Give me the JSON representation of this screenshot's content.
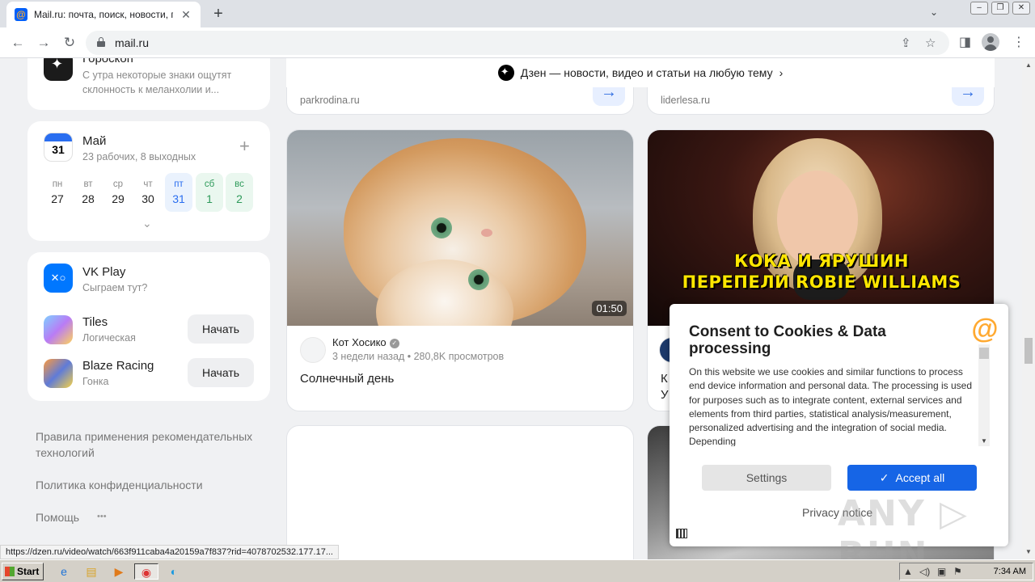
{
  "browser": {
    "tab_title": "Mail.ru: почта, поиск, новости, пр",
    "tab_close": "✕",
    "new_tab": "+",
    "url": "mail.ru",
    "status_url": "https://dzen.ru/video/watch/663f911caba4a20159a7f837?rid=4078702532.177.17..."
  },
  "sidebar": {
    "horoscope": {
      "title": "Гороскоп",
      "text": "С утра некоторые знаки ощутят склонность к меланхолии и..."
    },
    "calendar": {
      "icon_day": "31",
      "month": "Май",
      "summary": "23 рабочих, 8 выходных",
      "days": [
        {
          "name": "пн",
          "date": "27"
        },
        {
          "name": "вт",
          "date": "28"
        },
        {
          "name": "ср",
          "date": "29"
        },
        {
          "name": "чт",
          "date": "30"
        },
        {
          "name": "пт",
          "date": "31"
        },
        {
          "name": "сб",
          "date": "1"
        },
        {
          "name": "вс",
          "date": "2"
        }
      ]
    },
    "games": {
      "title": "VK Play",
      "subtitle": "Сыграем тут?",
      "icon_text": "✕○",
      "items": [
        {
          "name": "Tiles",
          "genre": "Логическая",
          "button": "Начать"
        },
        {
          "name": "Blaze Racing",
          "genre": "Гонка",
          "button": "Начать"
        }
      ]
    },
    "footer_links": [
      "Правила применения рекомендательных технологий",
      "Политика конфиденциальности",
      "Помощь"
    ],
    "more": "•••"
  },
  "feed": {
    "dzen_banner": "Дзен — новости, видео и статьи на любую тему",
    "top_cards": [
      {
        "source": "parkrodina.ru"
      },
      {
        "source": "liderlesa.ru"
      }
    ],
    "videos": [
      {
        "channel": "Кот Хосико",
        "meta": "3 недели назад • 280,8K просмотров",
        "title": "Солнечный день",
        "duration": "01:50"
      },
      {
        "caption_line1": "КОКА И ЯРУШИН",
        "caption_line2": "ПЕРЕПЕЛИ ROBIE WILLIAMS",
        "title_line1": "К",
        "title_line2": "У"
      }
    ]
  },
  "consent": {
    "title": "Consent to Cookies & Data processing",
    "text": "On this website we use cookies and similar functions to process end device information and personal data. The processing is used for purposes such as to integrate content, external services and elements from third parties, statistical analysis/measurement, personalized advertising and the integration of social media. Depending",
    "settings_label": "Settings",
    "accept_label": "Accept all",
    "privacy_label": "Privacy notice",
    "logo": "@"
  },
  "watermark": "ANY ▷ RUN",
  "taskbar": {
    "start": "Start",
    "clock": "7:34 AM"
  }
}
